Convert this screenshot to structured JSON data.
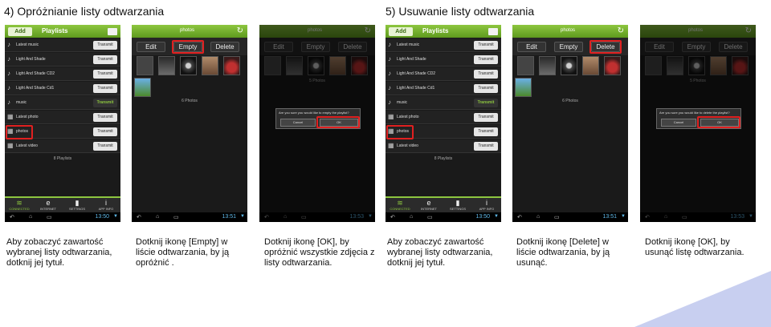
{
  "sections": [
    {
      "title": "4) Opróżnianie listy odtwarzania"
    },
    {
      "title": "5) Usuwanie listy odtwarzania"
    }
  ],
  "playlist_screen": {
    "add_label": "Add",
    "title": "Playlists",
    "rows": [
      {
        "name": "Latest music",
        "action": "Transmit"
      },
      {
        "name": "Light And Shade",
        "action": "Transmit"
      },
      {
        "name": "Light And Shade CD2",
        "action": "Transmit"
      },
      {
        "name": "Light And Shade Cd1",
        "action": "Transmit"
      },
      {
        "name": "music",
        "action": "Transmit"
      },
      {
        "name": "Latest photo",
        "action": "Transmit"
      },
      {
        "name": "photos",
        "action": "Transmit"
      },
      {
        "name": "Latest video",
        "action": "Transmit"
      }
    ],
    "count": "8 Playlists",
    "nav": [
      {
        "icon": "wifi-icon",
        "label": "CONNECTED"
      },
      {
        "icon": "internet-icon",
        "label": "INTERNET"
      },
      {
        "icon": "settings-icon",
        "label": "SETTINGS"
      },
      {
        "icon": "info-icon",
        "label": "APP INFO"
      }
    ]
  },
  "photos_screen": {
    "title": "photos",
    "edit": "Edit",
    "empty": "Empty",
    "delete": "Delete",
    "count": "6 Photos",
    "count_after": "5 Photos"
  },
  "dialogs": {
    "empty_question": "Are you sure you would like to empty the playlist?",
    "delete_question": "Are you sure you would like to delete the playlist?",
    "cancel": "Cancel",
    "ok": "OK"
  },
  "clock": [
    "13:50",
    "13:51",
    "13:53",
    "13:50",
    "13:51",
    "13:53"
  ],
  "captions": [
    "Aby zobaczyć zawartość wybranej listy odtwarzania, dotknij jej tytuł.",
    "Dotknij ikonę [Empty] w liście odtwarzania, by ją opróżnić .",
    "Dotknij ikonę [OK], by opróżnić wszystkie zdjęcia z listy odtwarzania.",
    "Aby zobaczyć zawartość wybranej listy odtwarzania, dotknij jej tytuł.",
    "Dotknij ikonę [Delete] w liście odtwarzania, by ją usunąć.",
    "Dotknij ikonę [OK], by usunąć listę odtwarzania."
  ],
  "colors": {
    "accent": "#8dc63f",
    "highlight": "#e02020",
    "decor": "#c8cff0"
  }
}
